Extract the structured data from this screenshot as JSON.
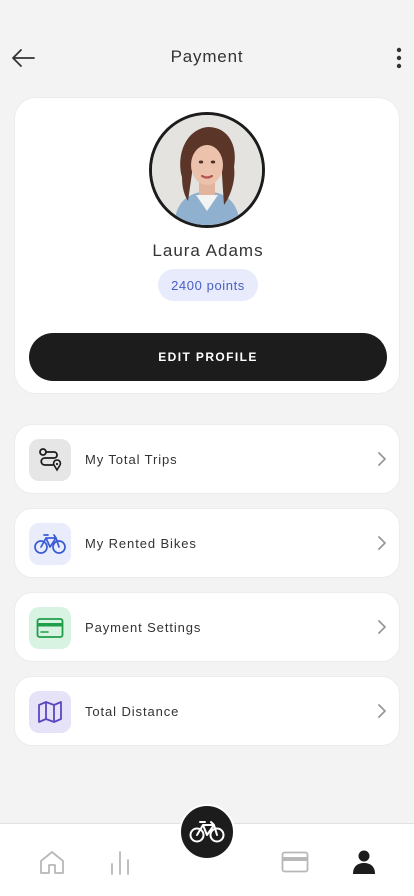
{
  "header": {
    "title": "Payment",
    "back_icon": "arrow-left-icon",
    "more_icon": "more-vertical-icon"
  },
  "profile": {
    "name": "Laura Adams",
    "points": "2400 points",
    "edit_label": "EDIT PROFILE"
  },
  "menu": {
    "items": [
      {
        "label": "My Total Trips",
        "icon": "route-icon",
        "color": "#e6e6e6"
      },
      {
        "label": "My Rented Bikes",
        "icon": "bicycle-icon",
        "color": "#e8ecfb"
      },
      {
        "label": "Payment Settings",
        "icon": "credit-card-icon",
        "color": "#d9f3e3"
      },
      {
        "label": "Total Distance",
        "icon": "map-icon",
        "color": "#e6e2f7"
      }
    ]
  },
  "tabbar": {
    "items": [
      "home-icon",
      "stats-icon",
      "bicycle-icon",
      "card-icon",
      "user-icon"
    ],
    "active": "user-icon"
  },
  "colors": {
    "accent_dark": "#1c1c1c",
    "points_bg": "#e7ebfb",
    "points_text": "#4a5fc7"
  }
}
